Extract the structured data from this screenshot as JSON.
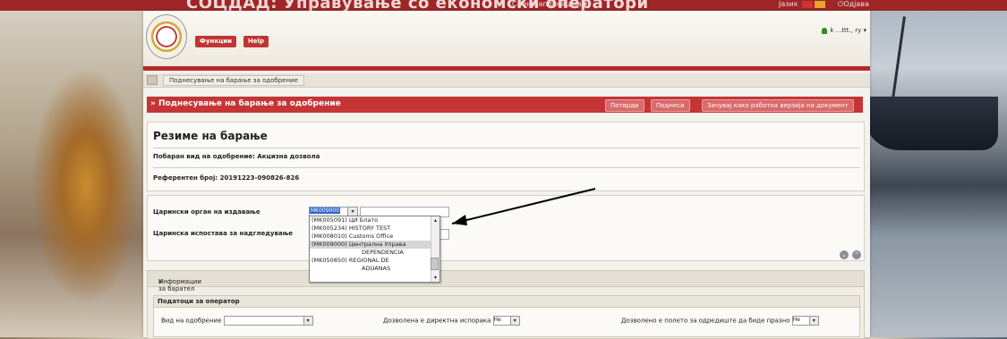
{
  "topbar": {
    "app_title": "СОЦДАД: Управување со економски оператори",
    "switch_app": "Смени апликација",
    "language": "Јазик",
    "logout": "Одјава"
  },
  "header": {
    "functions_button": "Функции",
    "help_button": "Help",
    "user_name": "k ...ttt., ry"
  },
  "breadcrumb": {
    "item": "Поднесување на барање за одобрение"
  },
  "titlebar": {
    "title": "» Поднесување на барање за одобрение",
    "confirm": "Потврди",
    "submit": "Поднеси",
    "save_draft": "Зачувај како работна верзија на документ"
  },
  "summary": {
    "heading": "Резиме на барање",
    "type_line": "Побаран вид на одобрение: Акцизна дозвола",
    "ref_line": "Референтен број: 20191223-090826-826"
  },
  "form": {
    "issuing_office_label": "Царински орган на издавање",
    "supervising_office_label": "Царинска испостава за надгледување",
    "selected_value": "MK009000",
    "dropdown_options": [
      "(MK005091) ЦИ Блато",
      "(MK005234) HISTORY TEST",
      "(MK008010) Customs Office",
      "(MK009000) Централна Управа",
      "DEPENDENCIA",
      "(MK050850) REGIONAL DE",
      "ADUANAS"
    ]
  },
  "info": {
    "section_title": "Информации за барател",
    "operator_title": "Податоци за оператор",
    "auth_type_label": "Вид на одобрение",
    "direct_export_label": "Дозволена е директна испорака",
    "direct_export_value": "Не",
    "empty_field_label": "Дозволено е полето за одредиште да биде празно",
    "empty_field_value": "Не"
  },
  "colors": {
    "brand_red": "#c53535",
    "top_red": "#9f2626"
  }
}
